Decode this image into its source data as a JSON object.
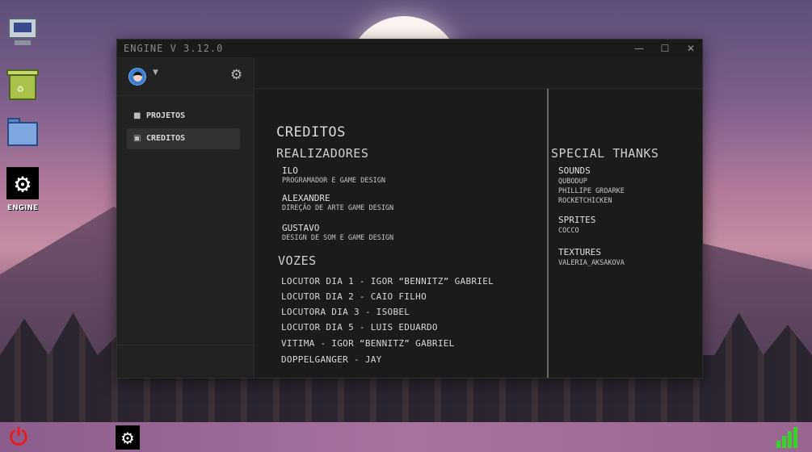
{
  "desktop": {
    "engine_label": "ENGINE"
  },
  "window": {
    "title": "ENGINE V 3.12.0",
    "controls": {
      "minimize": "—",
      "maximize": "☐",
      "close": "✕"
    }
  },
  "sidebar": {
    "items": [
      {
        "label": "PROJETOS",
        "icon": "cube-icon"
      },
      {
        "label": "CREDITOS",
        "icon": "lock-icon"
      }
    ]
  },
  "credits": {
    "title": "CREDITOS",
    "realizadores_heading": "REALIZADORES",
    "realizadores": [
      {
        "name": "ILO",
        "role": "PROGRAMADOR E GAME DESIGN"
      },
      {
        "name": "ALEXANDRE",
        "role": "DIREÇÃO DE ARTE GAME DESIGN"
      },
      {
        "name": "GUSTAVO",
        "role": "DESIGN DE SOM E GAME DESIGN"
      }
    ],
    "vozes_heading": "VOZES",
    "vozes": [
      "LOCUTOR DIA 1 - IGOR “BENNITZ” GABRIEL",
      "LOCUTOR DIA 2 - CAIO FILHO",
      "LOCUTORA DIA 3 - ISOBEL",
      "LOCUTOR DIA 5 - LUIS EDUARDO",
      "VITIMA - IGOR “BENNITZ” GABRIEL",
      "DOPPELGANGER - JAY"
    ]
  },
  "special_thanks": {
    "heading": "SPECIAL THANKS",
    "sounds_heading": "SOUNDS",
    "sounds": [
      "QUBODUP",
      "PHILLIPE GROARKE",
      "ROCKETCHICKEN"
    ],
    "sprites_heading": "SPRITES",
    "sprites": [
      "COCCO"
    ],
    "textures_heading": "TEXTURES",
    "textures": [
      "VALERIA_AKSAKOVA"
    ]
  },
  "colors": {
    "power": "#e02020",
    "signal": "#3ad12a",
    "window_bg": "#1c1c1c"
  }
}
